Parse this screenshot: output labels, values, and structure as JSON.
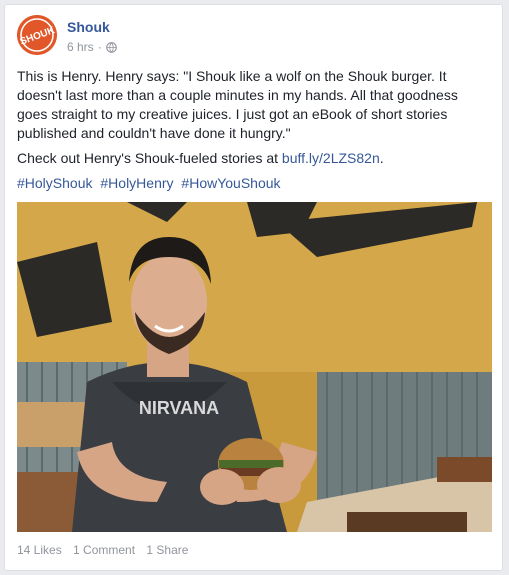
{
  "post": {
    "page_name": "Shouk",
    "avatar_text": "SHOUK",
    "timestamp": "6 hrs",
    "separator": "·",
    "audience_icon": "globe-icon",
    "body_paragraph_1": "This is Henry. Henry says: \"I Shouk like a wolf on the Shouk burger. It doesn't last more than a couple minutes in my hands. All that goodness goes straight to my creative juices. I just got an eBook of short stories published and couldn't have done it hungry.\"",
    "body_paragraph_2_text": "Check out Henry's Shouk-fueled stories at ",
    "body_paragraph_2_link": "buff.ly/2LZS82n",
    "body_paragraph_2_end": ".",
    "hashtags": [
      "#HolyShouk",
      "#HolyHenry",
      "#HowYouShouk"
    ],
    "photo_shirt_text": "NIRVANA"
  },
  "engagement": {
    "likes": "14 Likes",
    "comments": "1 Comment",
    "shares": "1 Share"
  },
  "colors": {
    "link": "#365899",
    "text": "#1d2129",
    "meta": "#90949c",
    "brand": "#e1572a",
    "wall": "#c89a3a"
  }
}
